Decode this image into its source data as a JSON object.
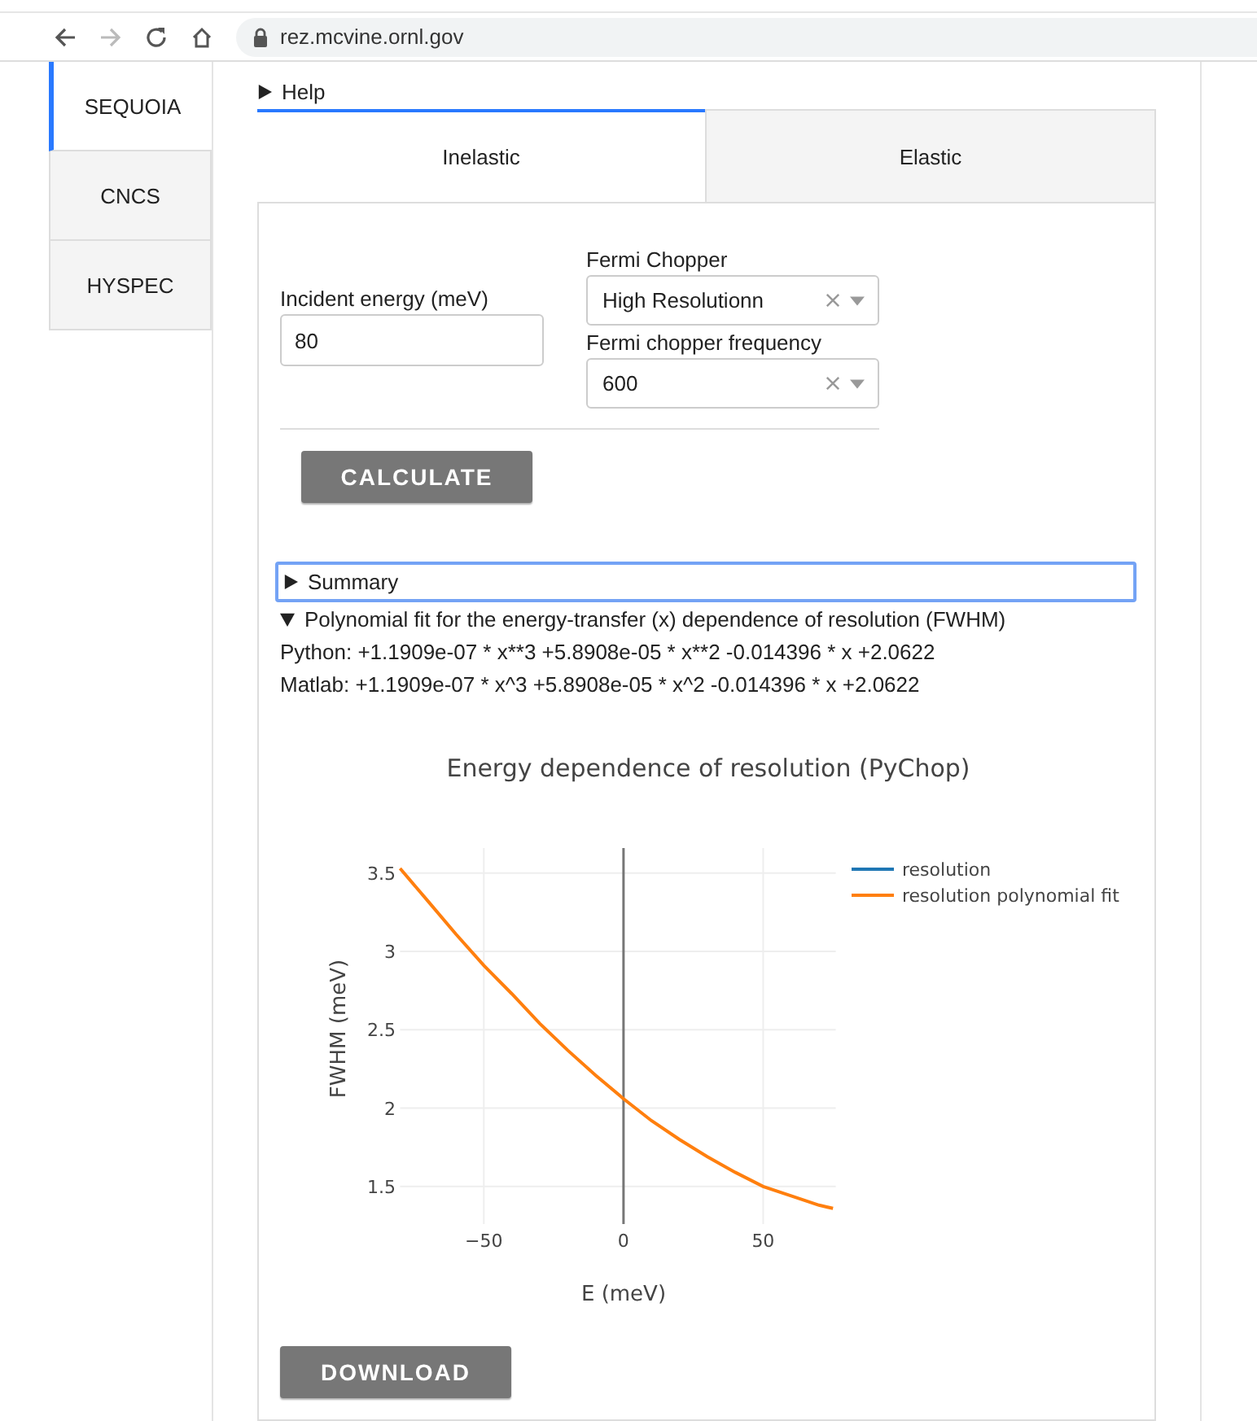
{
  "browser": {
    "url": "rez.mcvine.ornl.gov",
    "forward_disabled": true
  },
  "sidebar": {
    "items": [
      {
        "label": "SEQUOIA",
        "selected": true
      },
      {
        "label": "CNCS",
        "selected": false
      },
      {
        "label": "HYSPEC",
        "selected": false
      }
    ]
  },
  "help": {
    "label": "Help",
    "expanded": false
  },
  "tabs": [
    {
      "label": "Inelastic",
      "selected": true
    },
    {
      "label": "Elastic",
      "selected": false
    }
  ],
  "form": {
    "incident_energy": {
      "label": "Incident energy (meV)",
      "value": "80"
    },
    "fermi_chopper": {
      "label": "Fermi Chopper",
      "value": "High Resolutionn"
    },
    "frequency": {
      "label": "Fermi chopper frequency",
      "value": "600"
    }
  },
  "calculate_button": "CALCULATE",
  "summary": {
    "label": "Summary",
    "expanded": false,
    "focused": true
  },
  "polynomial_fit": {
    "label": "Polynomial fit for the energy-transfer (x) dependence of resolution (FWHM)",
    "expanded": true,
    "lines": [
      "Python: +1.1909e-07 * x**3 +5.8908e-05 * x**2 -0.014396 * x +2.0622",
      "Matlab: +1.1909e-07 * x^3 +5.8908e-05 * x^2 -0.014396 * x +2.0622"
    ]
  },
  "chart_data": {
    "type": "line",
    "title": "Energy dependence of resolution (PyChop)",
    "xlabel": "E (meV)",
    "ylabel": "FWHM (meV)",
    "x": [
      -80,
      -70,
      -60,
      -50,
      -40,
      -30,
      -20,
      -10,
      0,
      10,
      20,
      30,
      40,
      50,
      60,
      70,
      75
    ],
    "series": [
      {
        "name": "resolution",
        "color": "#1f77b4",
        "values": [
          null,
          null,
          null,
          null,
          null,
          null,
          null,
          null,
          null,
          null,
          null,
          null,
          null,
          null,
          null,
          null,
          null
        ]
      },
      {
        "name": "resolution polynomial fit",
        "color": "#ff7f0e",
        "values": [
          3.53,
          3.32,
          3.11,
          2.91,
          2.73,
          2.54,
          2.37,
          2.21,
          2.06,
          1.92,
          1.8,
          1.69,
          1.59,
          1.5,
          1.44,
          1.38,
          1.36
        ]
      }
    ],
    "grid": true,
    "legend": true,
    "xlim": [
      -80,
      76
    ],
    "ylim": [
      1.26,
      3.66
    ],
    "xticks": [
      {
        "value": -50,
        "label": "−50"
      },
      {
        "value": 0,
        "label": "0"
      },
      {
        "value": 50,
        "label": "50"
      }
    ],
    "yticks": [
      1.5,
      2,
      2.5,
      3,
      3.5
    ]
  },
  "download_button": "DOWNLOAD"
}
